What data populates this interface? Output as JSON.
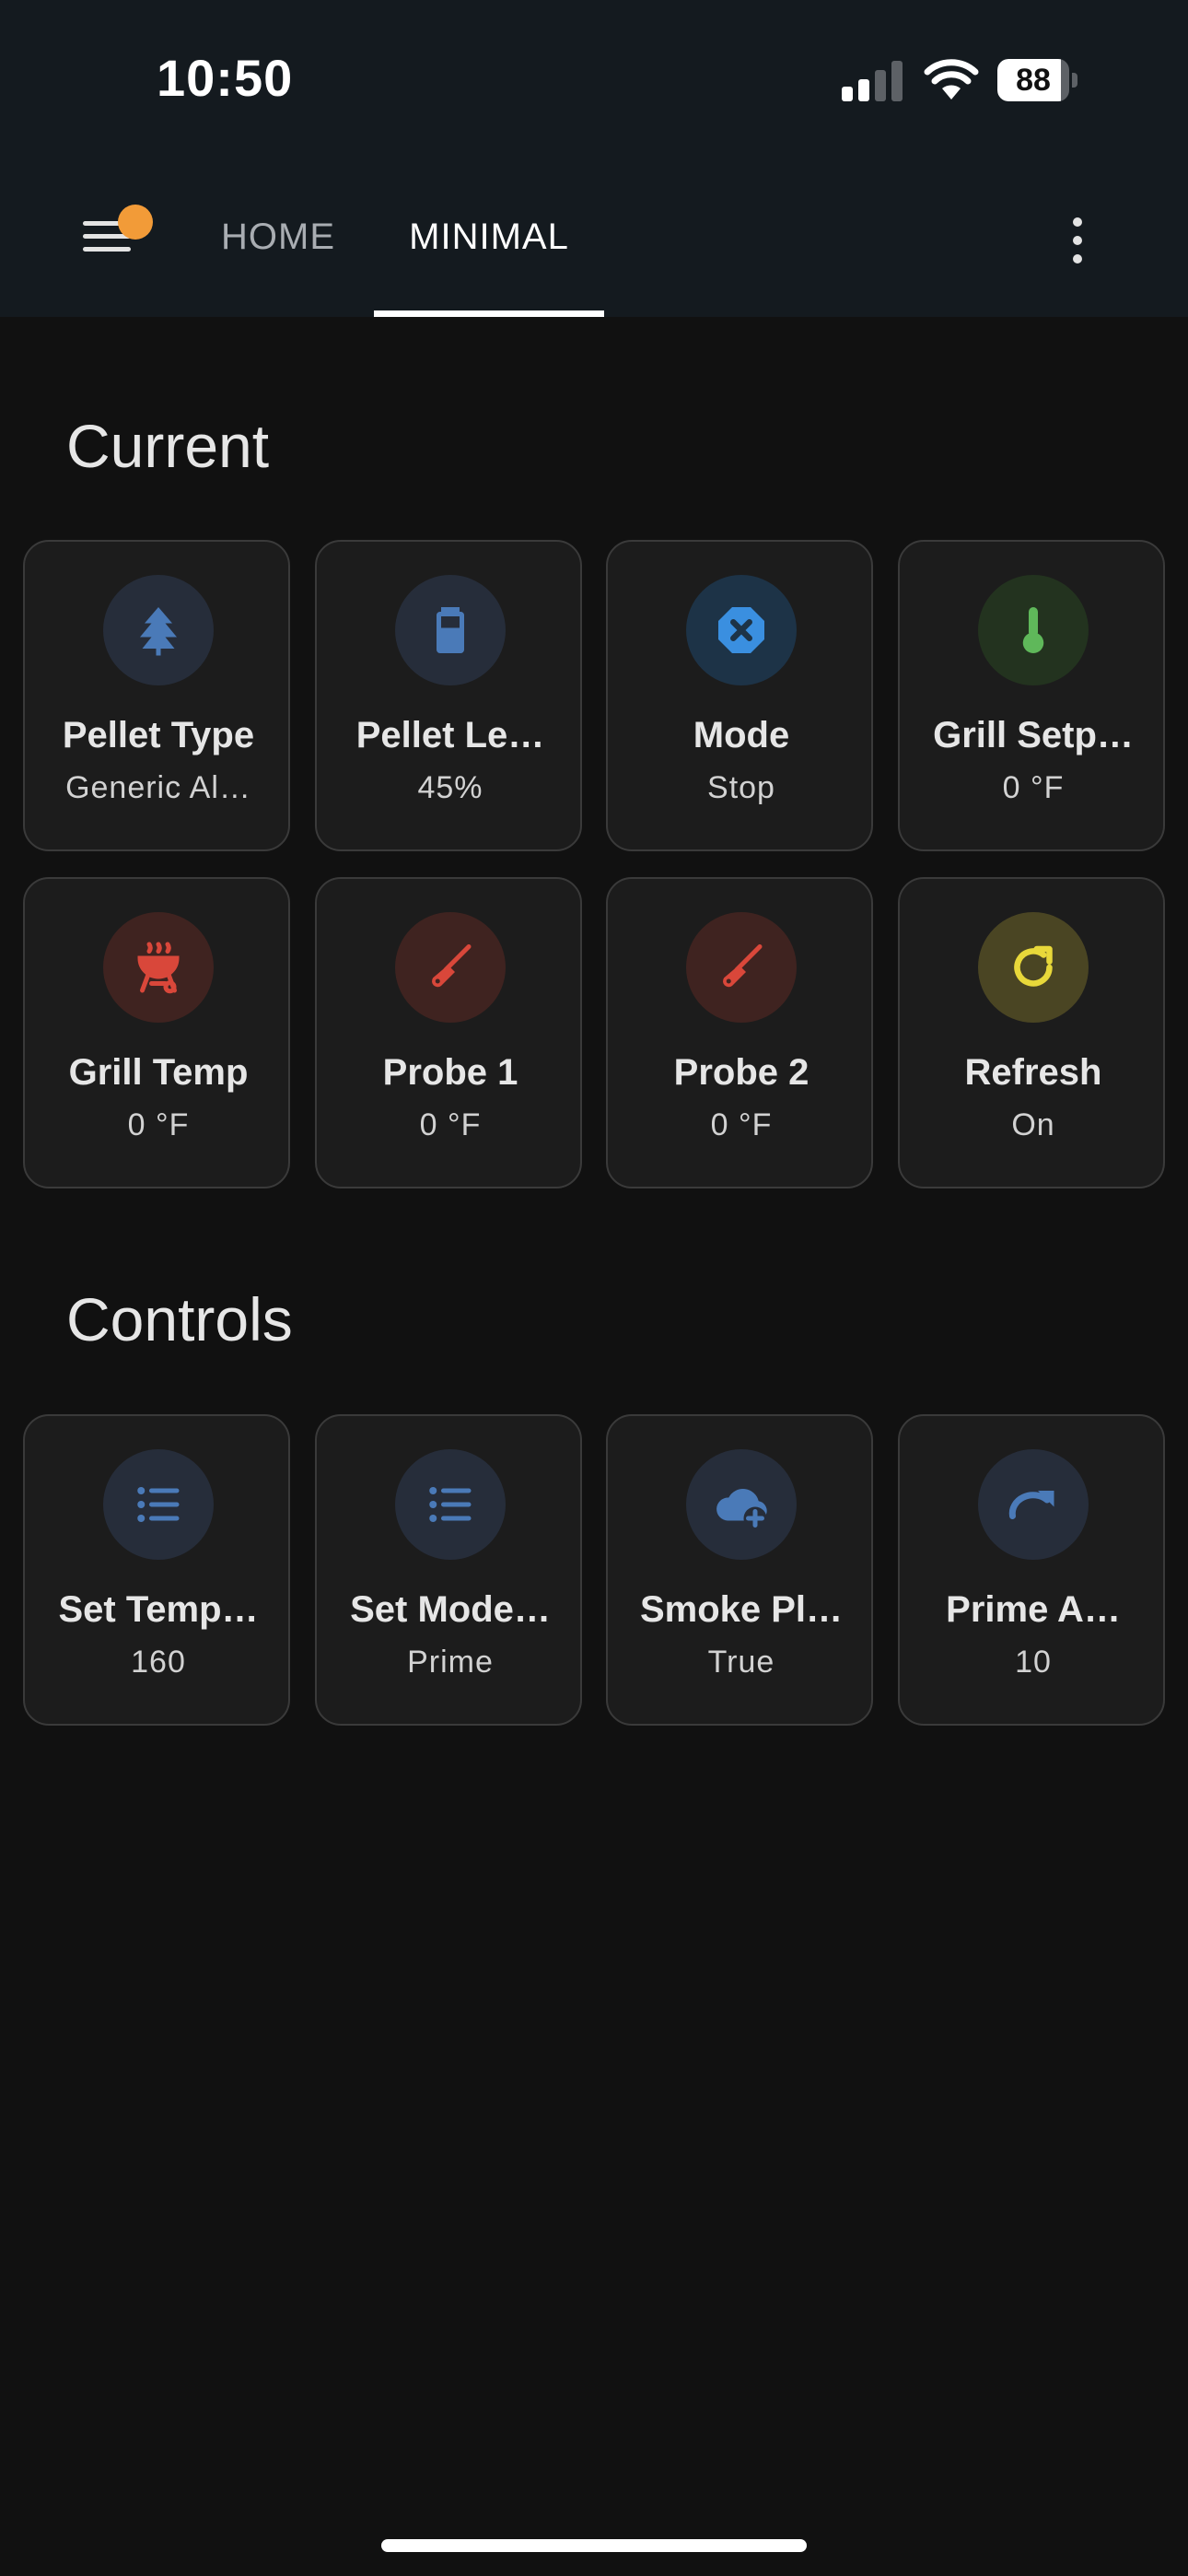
{
  "status_bar": {
    "time": "10:50",
    "battery_level": "88",
    "battery_fraction": 0.88
  },
  "toolbar": {
    "tabs": [
      {
        "label": "HOME",
        "active": false
      },
      {
        "label": "MINIMAL",
        "active": true
      }
    ],
    "menu_badge_color": "#f29b38"
  },
  "sections": {
    "current_title": "Current",
    "controls_title": "Controls"
  },
  "current": [
    {
      "name": "Pellet Type",
      "value": "Generic Al…",
      "icon": "pine-tree-icon",
      "icon_color": "#4a7ab8",
      "icon_bg": "#262d3a"
    },
    {
      "name": "Pellet Le…",
      "value": "45%",
      "icon": "battery-icon",
      "icon_color": "#4a7ab8",
      "icon_bg": "#262d3a"
    },
    {
      "name": "Mode",
      "value": "Stop",
      "icon": "close-octagon-icon",
      "icon_color": "#3a8fe0",
      "icon_bg": "#1d3347"
    },
    {
      "name": "Grill Setp…",
      "value": "0 °F",
      "icon": "thermometer-icon",
      "icon_color": "#5fb85a",
      "icon_bg": "#23331f"
    },
    {
      "name": "Grill Temp",
      "value": "0 °F",
      "icon": "grill-icon",
      "icon_color": "#d9473a",
      "icon_bg": "#3f2320"
    },
    {
      "name": "Probe 1",
      "value": "0 °F",
      "icon": "probe-icon",
      "icon_color": "#d9473a",
      "icon_bg": "#3f2320"
    },
    {
      "name": "Probe 2",
      "value": "0 °F",
      "icon": "probe-icon",
      "icon_color": "#d9473a",
      "icon_bg": "#3f2320"
    },
    {
      "name": "Refresh",
      "value": "On",
      "icon": "refresh-icon",
      "icon_color": "#e8d83a",
      "icon_bg": "#4a4523"
    }
  ],
  "controls": [
    {
      "name": "Set Temp…",
      "value": "160",
      "icon": "list-icon",
      "icon_color": "#4a7ab8",
      "icon_bg": "#262d3a"
    },
    {
      "name": "Set Mode…",
      "value": "Prime",
      "icon": "list-icon",
      "icon_color": "#4a7ab8",
      "icon_bg": "#262d3a"
    },
    {
      "name": "Smoke Pl…",
      "value": "True",
      "icon": "cloud-plus-icon",
      "icon_color": "#4a7ab8",
      "icon_bg": "#262d3a"
    },
    {
      "name": "Prime A…",
      "value": "10",
      "icon": "redo-icon",
      "icon_color": "#4a7ab8",
      "icon_bg": "#262d3a"
    }
  ]
}
